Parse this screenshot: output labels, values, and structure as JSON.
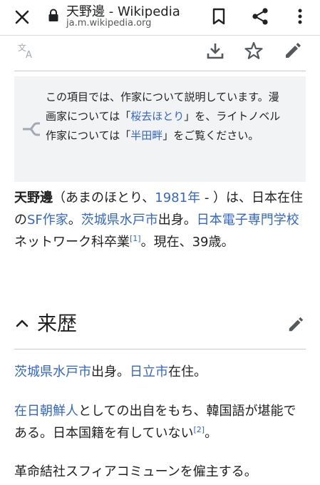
{
  "browser": {
    "page_title": "天野邊 - Wikipedia",
    "url": "ja.m.wikipedia.org"
  },
  "hatnote": {
    "line1": "この項目では、作家について説明しています。",
    "pre_link1": "漫画家については「",
    "link1": "桜去ほとり",
    "post_link1": "」を、ライトノベル作家については「",
    "link2": "半田畔",
    "post_link2": "」をご覧ください。"
  },
  "lead": {
    "name": "天野邊",
    "p1": "（あまのほとり、",
    "year_link": "1981年",
    "p2": " - ）は、日本在住の",
    "sf_link": "SF作家",
    "p3": "。",
    "pref_link": "茨城県",
    "city_link": "水戸市",
    "p4": "出身。",
    "school_link": "日本電子専門学校",
    "p5": "ネットワーク科卒業",
    "ref1": "[1]",
    "p6": "。現在、39歳。"
  },
  "section": {
    "title": "来歴"
  },
  "para1": {
    "pref_link": "茨城県",
    "city_link": "水戸市",
    "t1": "出身。",
    "hitachi_link": "日立市",
    "t2": "在住。"
  },
  "para2": {
    "link": "在日朝鮮人",
    "t1": "としての出自をもち、韓国語が堪能である。日本国籍を有していない",
    "ref2": "[2]",
    "t2": "。"
  },
  "para3": {
    "text": "革命結社スフィアコミューンを僱主する。"
  },
  "colors": {
    "link": "#3366cc",
    "text": "#202122",
    "icon": "#54595d",
    "hatnote_bg": "#f2f3f5"
  }
}
